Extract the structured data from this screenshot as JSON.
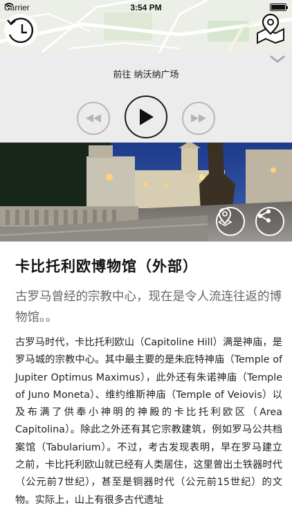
{
  "status_bar": {
    "carrier": "Carrier",
    "time": "3:54 PM"
  },
  "map": {
    "history_icon": "clock-history-icon",
    "pins_icon": "map-pins-icon"
  },
  "player": {
    "title": "前往 纳沃纳广场",
    "rewind_icon": "rewind-icon",
    "play_icon": "play-icon",
    "forward_icon": "fast-forward-icon",
    "collapse_icon": "chevron-down-icon"
  },
  "photo": {
    "pin_icon": "map-pin-icon",
    "share_icon": "share-icon"
  },
  "article": {
    "title": "卡比托利欧博物馆（外部）",
    "subtitle": "古罗马曾经的宗教中心，现在是令人流连往返的博物馆。。",
    "body": "古罗马时代，卡比托利欧山（Capitoline Hill）满是神庙，是罗马城的宗教中心。其中最主要的是朱庇特神庙（Temple of Jupiter Optimus Maximus），此外还有朱诺神庙（Temple of Juno Moneta）、维约维斯神庙（Temple of Veiovis）以及布满了供奉小神明的神殿的卡比托利欧区（Area Capitolina）。除此之外还有其它宗教建筑，例如罗马公共档案馆（Tabularium）。不过，考古发现表明，早在罗马建立之前，卡比托利欧山就已经有人类居住，这里曾出土铁器时代（公元前7世纪），甚至是铜器时代（公元前15世纪）的文物。实际上，山上有很多古代遗址"
  }
}
